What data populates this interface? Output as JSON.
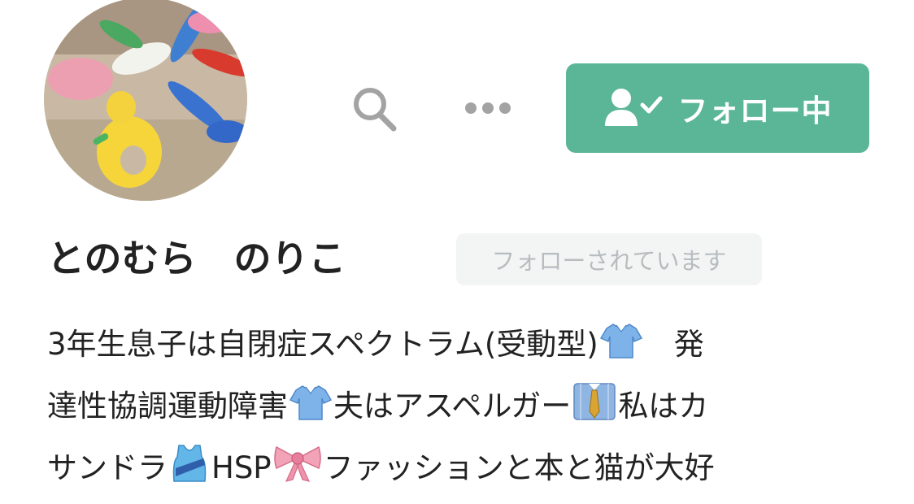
{
  "profile": {
    "name": "とのむら　のりこ",
    "follows_you_badge": "フォローされています",
    "follow_button_label": "フォロー中",
    "bio": {
      "line1": "3年生息子は自閉症スペクトラム(受動型)",
      "line1_tail": "　発",
      "line2_a": "達性協調運動障害",
      "line2_b": "夫はアスペルガー",
      "line2_c": "私はカ",
      "line3_a": "サンドラ",
      "line3_b": "HSP",
      "line3_c": "ファッションと本と猫が大好"
    }
  },
  "icons": {
    "search": "search-icon",
    "more": "more-dots-icon",
    "follow": "user-check-icon",
    "shirt": "blue-shirt-emoji",
    "suit": "necktie-shirt-emoji",
    "tank": "running-shirt-emoji",
    "ribbon": "ribbon-emoji"
  },
  "colors": {
    "accent": "#5bb698",
    "text": "#222222",
    "badge_bg": "#f3f5f5",
    "badge_text": "#b7bcbe",
    "icon_gray": "#a3a3a3"
  }
}
